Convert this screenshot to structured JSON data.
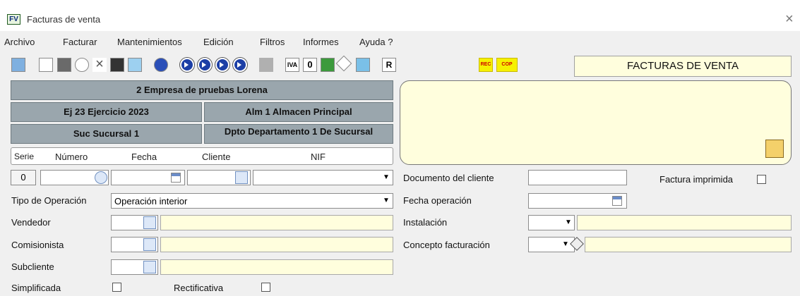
{
  "window": {
    "app_icon": "FV",
    "title": "Facturas de venta",
    "close": "×"
  },
  "menu": [
    "Archivo",
    "Facturar",
    "Mantenimientos",
    "Edición",
    "Filtros",
    "Informes",
    "Ayuda ?"
  ],
  "toolbar": {
    "icons": [
      "refresh-icon",
      "new-document-icon",
      "save-icon",
      "search-icon",
      "delete-icon",
      "print-icon",
      "columns-icon",
      "help-icon",
      "first-record-icon",
      "previous-record-icon",
      "next-record-icon",
      "last-record-icon",
      "flag-icon",
      "iva-icon",
      "zero-icon",
      "cash-icon",
      "eraser-icon",
      "calculator-icon",
      "r-icon",
      "rec-icon",
      "cop-icon"
    ],
    "iva_label": "IVA",
    "zero_label": "0",
    "r_label": "R",
    "rec_label": "REC",
    "cop_label": "COP",
    "highlight_color": "#f6f100"
  },
  "banner": "FACTURAS DE VENTA",
  "company": {
    "empresa": "2 Empresa de pruebas Lorena",
    "ejercicio": "Ej 23 Ejercicio 2023",
    "almacen": "Alm 1 Almacen Principal",
    "sucursal": "Suc Sucursal 1",
    "departamento": "Dpto Departamento 1 De Sucursal"
  },
  "columns": {
    "serie": "Serie",
    "numero": "Número",
    "fecha": "Fecha",
    "cliente": "Cliente",
    "nif": "NIF"
  },
  "serie_button": "0",
  "fields": {
    "tipo_operacion": {
      "label": "Tipo de Operación",
      "value": "Operación interior"
    },
    "vendedor": "Vendedor",
    "comisionista": "Comisionista",
    "subcliente": "Subcliente",
    "simplificada": "Simplificada",
    "rectificativa": "Rectificativa",
    "documento_cliente": "Documento del cliente",
    "factura_impresa": "Factura imprimida",
    "fecha_operacion": "Fecha operación",
    "instalacion": "Instalación",
    "concepto_facturacion": "Concepto facturación"
  },
  "colors": {
    "label_box": "#9aa6ad",
    "note_bg": "#fffedd"
  }
}
